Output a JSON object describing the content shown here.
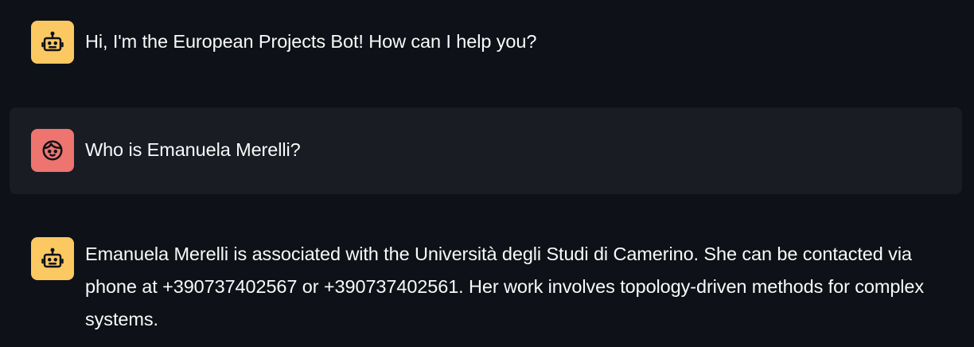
{
  "colors": {
    "background": "#0e1117",
    "user_message_bg": "#1a1c24",
    "bot_avatar": "#fbc862",
    "user_avatar": "#ee746f",
    "text": "#fafafa"
  },
  "messages": [
    {
      "role": "assistant",
      "icon": "robot-icon",
      "text": "Hi, I'm the European Projects Bot! How can I help you?"
    },
    {
      "role": "user",
      "icon": "face-icon",
      "text": "Who is Emanuela Merelli?"
    },
    {
      "role": "assistant",
      "icon": "robot-icon",
      "text": "Emanuela Merelli is associated with the Università degli Studi di Camerino. She can be contacted via phone at +390737402567 or +390737402561. Her work involves topology-driven methods for complex systems."
    }
  ]
}
